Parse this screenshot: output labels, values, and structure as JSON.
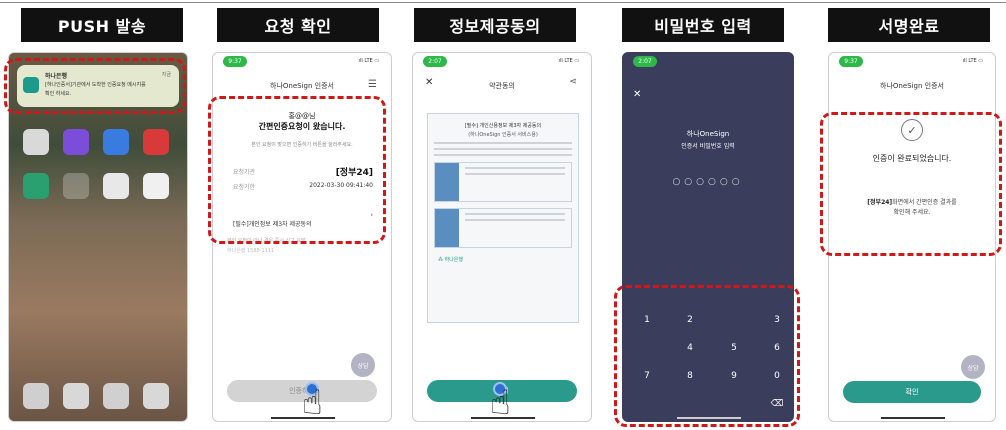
{
  "steps": [
    {
      "title": "PUSH 발송"
    },
    {
      "title": "요청 확인"
    },
    {
      "title": "정보제공동의"
    },
    {
      "title": "비밀번호 입력"
    },
    {
      "title": "서명완료"
    }
  ],
  "phone1": {
    "notif_app": "하나은행",
    "notif_line1": "[하나인증서]기관에서 도착한 인증요청 메시지를",
    "notif_line2": "확인 하세요.",
    "notif_time": "지금"
  },
  "phone2": {
    "time": "9:37",
    "signal": "ıll LTE ▭",
    "header": "하나OneSign 인증서",
    "greeting": "홍@@님",
    "message": "간편인증요청이 왔습니다.",
    "subtext": "본인 요청이 맞으면 인증하기 버튼을 눌러주세요.",
    "org_label": "요청기관",
    "org_value": "[정부24]",
    "date_label": "요청기한",
    "date_value": "2022-03-30 09:41:40",
    "agree_item": "[필수]개인정보 제3자 제공동의",
    "warning": "본인 요청이 아닌 경우 즉시 신고 요망",
    "phone_num": "하나은행 1588-1111",
    "button": "인증하기",
    "chat": "상담"
  },
  "phone3": {
    "time": "2:07",
    "signal": "ıll LTE ▭",
    "header": "약관동의",
    "doc_title": "[필수] 개인신용정보 제3자 제공동의",
    "doc_sub": "(하나OneSign 인증서 서비스용)",
    "logo": "하나은행",
    "button": "동의"
  },
  "phone4": {
    "time": "2:07",
    "header1": "하나OneSign",
    "header2": "인증서 비밀번호 입력",
    "keys": [
      "1",
      "2",
      "",
      "3",
      "",
      "4",
      "5",
      "6",
      "7",
      "8",
      "9",
      "0",
      "",
      "",
      "",
      "⌫"
    ]
  },
  "phone5": {
    "time": "9:37",
    "signal": "ıll LTE ▭",
    "header": "하나OneSign 인증서",
    "message": "인증이 완료되었습니다.",
    "org": "[정부24]",
    "line1": "화면에서 간편인증 결과를",
    "line2": "확인해 주세요.",
    "button": "확인",
    "chat": "상담"
  }
}
